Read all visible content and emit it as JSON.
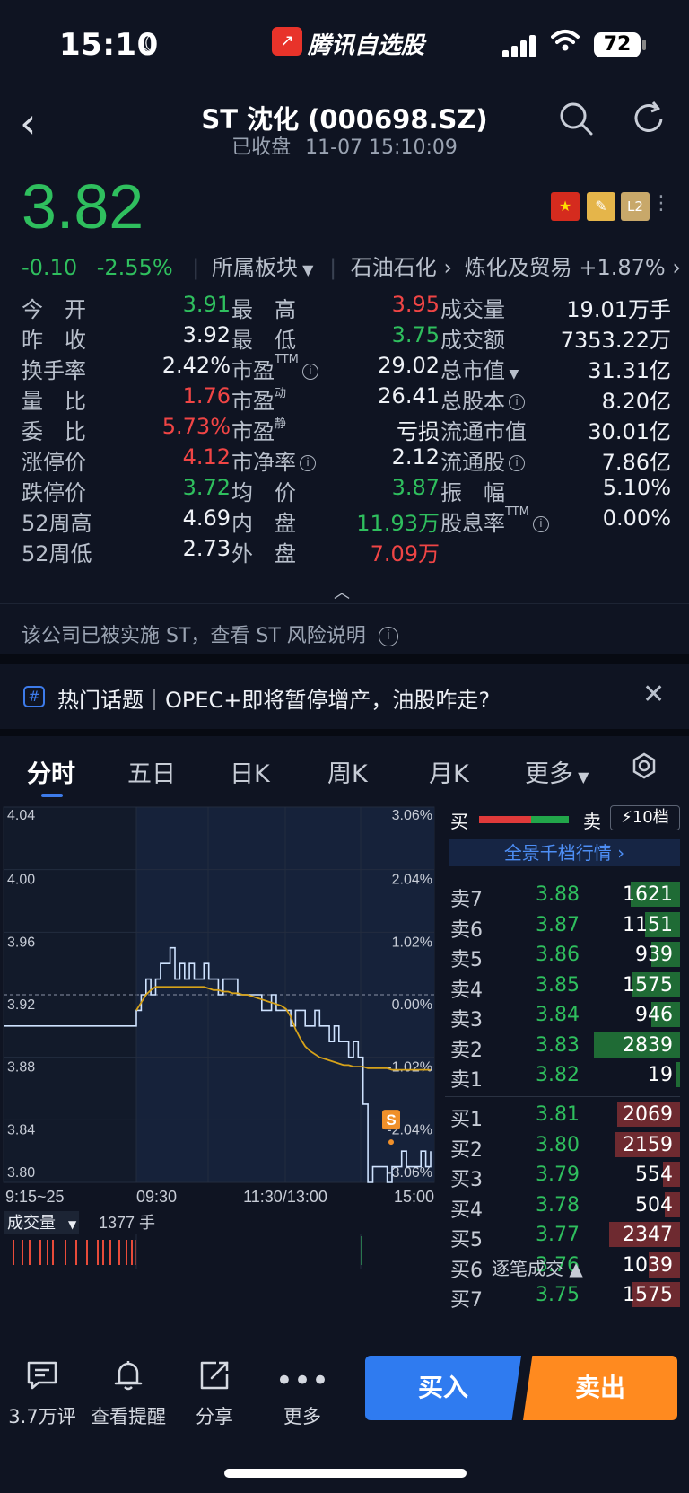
{
  "status": {
    "time": "15:10",
    "app_name": "腾讯自选股",
    "battery": "72"
  },
  "header": {
    "title": "ST 沈化 (000698.SZ)",
    "state": "已收盘",
    "datetime": "11-07 15:10:09"
  },
  "quote": {
    "price": "3.82",
    "change": "-0.10",
    "change_pct": "-2.55%",
    "sector_label": "所属板块",
    "sector": "石油石化",
    "sub_sector": "炼化及贸易",
    "sub_sector_change": "+1.87%",
    "badges": {
      "l2": "L2"
    }
  },
  "stats": {
    "col1": [
      {
        "label": "今　开",
        "value": "3.91",
        "color": "green"
      },
      {
        "label": "昨　收",
        "value": "3.92",
        "color": "white"
      },
      {
        "label": "换手率",
        "value": "2.42%",
        "color": "white"
      },
      {
        "label": "量　比",
        "value": "1.76",
        "color": "red"
      },
      {
        "label": "委　比",
        "value": "5.73%",
        "color": "red"
      },
      {
        "label": "涨停价",
        "value": "4.12",
        "color": "red"
      },
      {
        "label": "跌停价",
        "value": "3.72",
        "color": "green"
      },
      {
        "label": "52周高",
        "value": "4.69",
        "color": "white"
      },
      {
        "label": "52周低",
        "value": "2.73",
        "color": "white"
      }
    ],
    "col2": [
      {
        "label": "最　高",
        "value": "3.95",
        "color": "red"
      },
      {
        "label": "最　低",
        "value": "3.75",
        "color": "green"
      },
      {
        "label": "市盈",
        "sup": "TTM",
        "info": true,
        "value": "29.02",
        "color": "white"
      },
      {
        "label": "市盈",
        "sup": "动",
        "value": "26.41",
        "color": "white"
      },
      {
        "label": "市盈",
        "sup": "静",
        "value": "亏损",
        "color": "white"
      },
      {
        "label": "市净率",
        "info": true,
        "value": "2.12",
        "color": "white"
      },
      {
        "label": "均　价",
        "value": "3.87",
        "color": "green"
      },
      {
        "label": "内　盘",
        "value": "11.93万",
        "color": "green"
      },
      {
        "label": "外　盘",
        "value": "7.09万",
        "color": "red"
      }
    ],
    "col3": [
      {
        "label": "成交量",
        "value": "19.01万手",
        "color": "white"
      },
      {
        "label": "成交额",
        "value": "7353.22万",
        "color": "white"
      },
      {
        "label": "总市值",
        "dropdown": true,
        "value": "31.31亿",
        "color": "white"
      },
      {
        "label": "总股本",
        "info": true,
        "value": "8.20亿",
        "color": "white"
      },
      {
        "label": "流通市值",
        "value": "30.01亿",
        "color": "white"
      },
      {
        "label": "流通股",
        "info": true,
        "value": "7.86亿",
        "color": "white"
      },
      {
        "label": "振　幅",
        "value": "5.10%",
        "color": "white"
      },
      {
        "label": "股息率",
        "sup": "TTM",
        "info": true,
        "value": "0.00%",
        "color": "white"
      }
    ]
  },
  "st_notice": "该公司已被实施 ST，查看 ST 风险说明",
  "topic": "热门话题｜OPEC+即将暂停增产，油股咋走?",
  "tabs": [
    "分时",
    "五日",
    "日K",
    "周K",
    "月K",
    "更多"
  ],
  "chart_data": {
    "type": "line",
    "y_left_ticks": [
      "4.04",
      "4.00",
      "3.96",
      "3.92",
      "3.88",
      "3.84",
      "3.80"
    ],
    "y_right_ticks": [
      "3.06%",
      "2.04%",
      "1.02%",
      "0.00%",
      "-1.02%",
      "-2.04%",
      "-3.06%"
    ],
    "x_ticks": [
      "9:15~25",
      "09:30",
      "11:30/13:00",
      "15:00"
    ],
    "ylim": [
      3.8,
      4.04
    ],
    "prev_close": 3.92,
    "series": [
      {
        "values": [
          3.9,
          3.9,
          3.9,
          3.9,
          3.9,
          3.9,
          3.9,
          3.9,
          3.9,
          3.9,
          3.9,
          3.9,
          3.9,
          3.9,
          3.91,
          3.92,
          3.93,
          3.92,
          3.93,
          3.94,
          3.94,
          3.95,
          3.93,
          3.94,
          3.93,
          3.94,
          3.93,
          3.93,
          3.94,
          3.93,
          3.93,
          3.92,
          3.93,
          3.93,
          3.93,
          3.92,
          3.92,
          3.92,
          3.92,
          3.92,
          3.91,
          3.91,
          3.92,
          3.91,
          3.91,
          3.91,
          3.9,
          3.91,
          3.91,
          3.9,
          3.9,
          3.91,
          3.9,
          3.9,
          3.89,
          3.9,
          3.89,
          3.89,
          3.88,
          3.89,
          3.88,
          3.85,
          3.8,
          3.81,
          3.81,
          3.81,
          3.8,
          3.81,
          3.81,
          3.82,
          3.81,
          3.81,
          3.81,
          3.82,
          3.81,
          3.82
        ]
      },
      {
        "values": [
          null,
          null,
          null,
          null,
          null,
          null,
          null,
          null,
          null,
          null,
          null,
          null,
          null,
          null,
          3.91,
          3.915,
          3.92,
          3.923,
          3.925,
          3.925,
          3.925,
          3.925,
          3.925,
          3.925,
          3.925,
          3.925,
          3.925,
          3.925,
          3.925,
          3.924,
          3.923,
          3.923,
          3.922,
          3.922,
          3.921,
          3.921,
          3.92,
          3.92,
          3.919,
          3.918,
          3.917,
          3.916,
          3.915,
          3.914,
          3.913,
          3.911,
          3.906,
          3.898,
          3.892,
          3.887,
          3.884,
          3.882,
          3.88,
          3.879,
          3.878,
          3.877,
          3.876,
          3.875,
          3.875,
          3.874,
          3.874,
          3.874,
          3.873,
          3.873,
          3.873,
          3.873,
          3.873,
          3.872,
          3.872,
          3.872,
          3.872,
          3.872,
          3.872,
          3.872,
          3.872,
          3.872
        ]
      }
    ],
    "volume_label": "成交量",
    "volume_value": "1377 手",
    "marker": "S"
  },
  "orderbook": {
    "buy_label": "买",
    "sell_label": "卖",
    "depth_button": "10档",
    "full_depth": "全景千档行情",
    "asks": [
      {
        "label": "卖7",
        "price": "3.88",
        "volume": "1621",
        "vol": 1621
      },
      {
        "label": "卖6",
        "price": "3.87",
        "volume": "1151",
        "vol": 1151
      },
      {
        "label": "卖5",
        "price": "3.86",
        "volume": "939",
        "vol": 939
      },
      {
        "label": "卖4",
        "price": "3.85",
        "volume": "1575",
        "vol": 1575
      },
      {
        "label": "卖3",
        "price": "3.84",
        "volume": "946",
        "vol": 946
      },
      {
        "label": "卖2",
        "price": "3.83",
        "volume": "2839",
        "vol": 2839
      },
      {
        "label": "卖1",
        "price": "3.82",
        "volume": "19",
        "vol": 19
      }
    ],
    "bids": [
      {
        "label": "买1",
        "price": "3.81",
        "volume": "2069",
        "vol": 2069
      },
      {
        "label": "买2",
        "price": "3.80",
        "volume": "2159",
        "vol": 2159
      },
      {
        "label": "买3",
        "price": "3.79",
        "volume": "554",
        "vol": 554
      },
      {
        "label": "买4",
        "price": "3.78",
        "volume": "504",
        "vol": 504
      },
      {
        "label": "买5",
        "price": "3.77",
        "volume": "2347",
        "vol": 2347
      },
      {
        "label": "买6",
        "price": "3.76",
        "volume": "1039",
        "vol": 1039
      },
      {
        "label": "买7",
        "price": "3.75",
        "volume": "1575",
        "vol": 1575
      }
    ],
    "ticks_label": "逐笔成交"
  },
  "bottom": {
    "comments": "3.7万评",
    "alerts": "查看提醒",
    "share": "分享",
    "more": "更多",
    "buy": "买入",
    "sell": "卖出"
  },
  "colors": {
    "up": "#f04545",
    "down": "#2fbf5e",
    "accent": "#3d7bea",
    "avg_line": "#d6a21a"
  }
}
